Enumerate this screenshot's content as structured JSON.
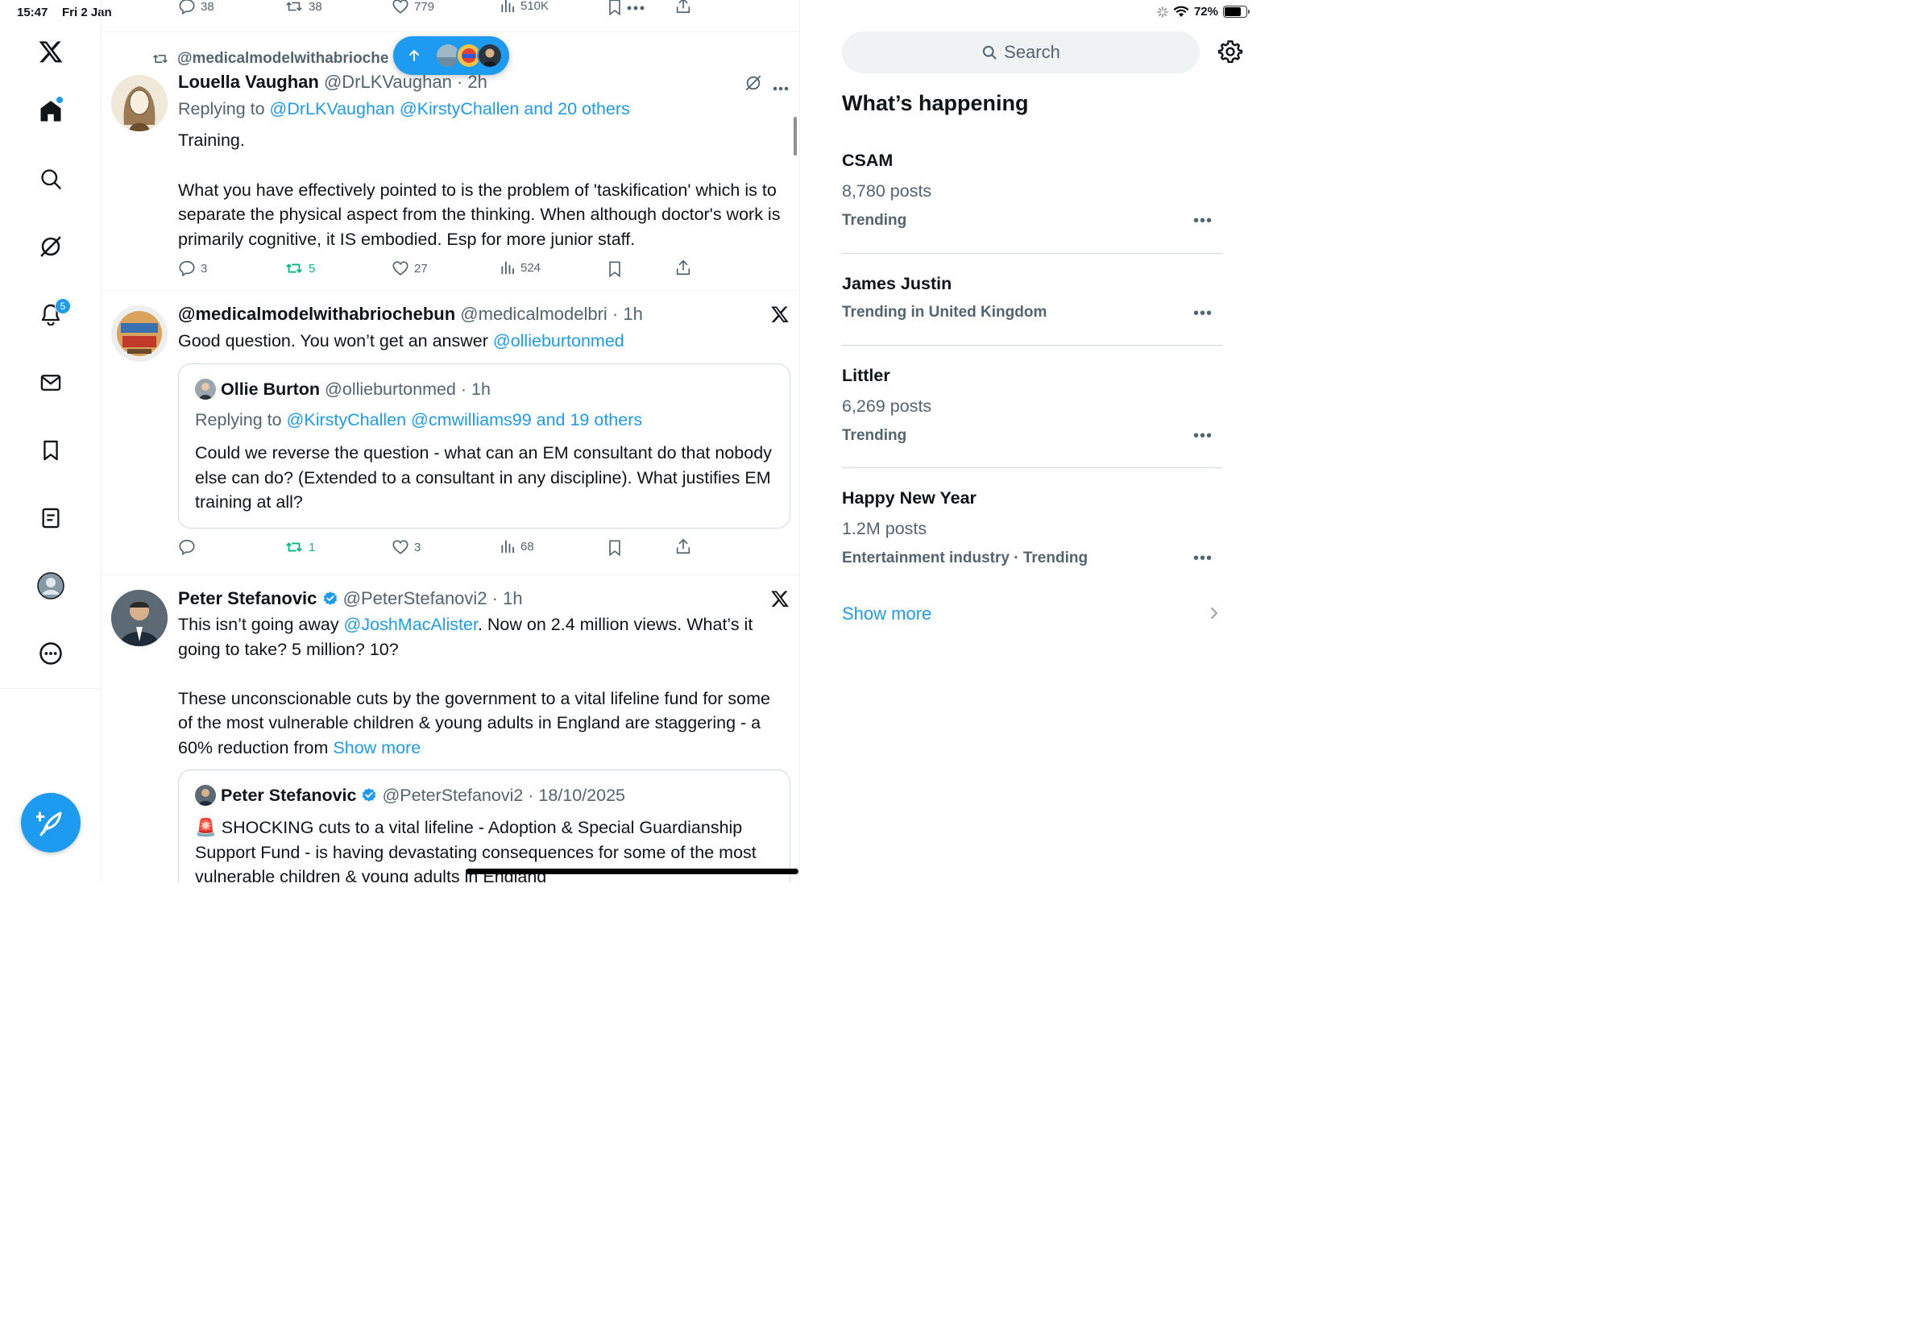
{
  "status_bar": {
    "time": "15:47",
    "date": "Fri 2 Jan",
    "battery": "72%"
  },
  "nav": {
    "notifications_badge": "5"
  },
  "top_actions": {
    "replies": "38",
    "reposts": "38",
    "likes": "779",
    "views": "510K"
  },
  "new_posts_pill": {
    "icon": "arrow-up-icon"
  },
  "tweets": [
    {
      "repost_by": "@medicalmodelwithabrioche",
      "name": "Louella Vaughan",
      "handle": "@DrLKVaughan · 2h",
      "replying_prefix": "Replying to ",
      "replying_to": "@DrLKVaughan @KirstyChallen and 20 others",
      "body_1": "Training.",
      "body_2": "What you have effectively pointed to is the problem of 'taskification' which is to separate the physical aspect from the thinking. When although doctor's work is primarily cognitive, it IS embodied. Esp for more junior staff.",
      "replies": "3",
      "reposts": "5",
      "likes": "27",
      "views": "524"
    },
    {
      "name": "@medicalmodelwithabriochebun",
      "handle": "@medicalmodelbri · 1h",
      "body": "Good question. You won’t get an answer ",
      "mention": "@ollieburtonmed",
      "quote": {
        "name": "Ollie Burton",
        "handle": "@ollieburtonmed · 1h",
        "replying_prefix": "Replying to ",
        "replying_to": "@KirstyChallen @cmwilliams99 and 19 others",
        "body": "Could we reverse the question - what can an EM consultant do that nobody else can do? (Extended to a consultant in any discipline). What justifies EM training at all?"
      },
      "replies": "",
      "reposts": "1",
      "likes": "3",
      "views": "68"
    },
    {
      "name": "Peter Stefanovic",
      "handle": "@PeterStefanovi2 · 1h",
      "body_a": "This isn’t going away ",
      "mention": "@JoshMacAlister",
      "body_b": ". Now on 2.4 million views. What’s it going to take? 5 million? 10?",
      "body_2": "These unconscionable cuts by the government to a vital lifeline fund for some of the most vulnerable children & young adults in England are staggering - a 60% reduction from ",
      "show_more": "Show more",
      "quote": {
        "name": "Peter Stefanovic",
        "handle": "@PeterStefanovi2 · 18/10/2025",
        "body": "🚨 SHOCKING cuts to a vital lifeline - Adoption & Special Guardianship Support Fund - is having devastating consequences for some of the most vulnerable children & young adults in England"
      }
    }
  ],
  "sidebar": {
    "search_placeholder": "Search",
    "section_title": "What’s happening",
    "trends": [
      {
        "title": "CSAM",
        "posts": "8,780 posts",
        "meta": "Trending"
      },
      {
        "title": "James Justin",
        "posts": "",
        "meta": "Trending in United Kingdom"
      },
      {
        "title": "Littler",
        "posts": "6,269 posts",
        "meta": "Trending"
      },
      {
        "title": "Happy New Year",
        "posts": "1.2M posts",
        "meta": "Entertainment industry · Trending"
      }
    ],
    "show_more": "Show more"
  },
  "colors": {
    "accent": "#1d9bf0",
    "repost_green": "#00ba7c",
    "text_secondary": "#536471"
  }
}
